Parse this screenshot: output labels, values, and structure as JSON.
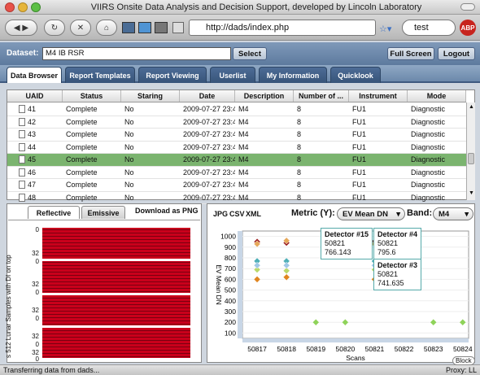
{
  "window": {
    "title": "VIIRS Onsite Data Analysis and Decision Support, developed by Lincoln Laboratory"
  },
  "toolbar": {
    "url": "http://dads/index.php",
    "search": "test",
    "abp": "ABP"
  },
  "dataset": {
    "label": "Dataset:",
    "value": "M4 IB RSR",
    "select_label": "Select",
    "fullscreen_label": "Full Screen",
    "logout_label": "Logout"
  },
  "tabs": [
    "Data Browser",
    "Report Templates",
    "Report Viewing",
    "Userlist",
    "My Information",
    "Quicklook"
  ],
  "table": {
    "columns": [
      "UAID",
      "Status",
      "Staring",
      "Date",
      "Description",
      "Number of ...",
      "Instrument",
      "Mode"
    ],
    "rows": [
      [
        "41",
        "Complete",
        "No",
        "2009-07-27 23:4",
        "M4",
        "8",
        "FU1",
        "Diagnostic"
      ],
      [
        "42",
        "Complete",
        "No",
        "2009-07-27 23:4",
        "M4",
        "8",
        "FU1",
        "Diagnostic"
      ],
      [
        "43",
        "Complete",
        "No",
        "2009-07-27 23:4",
        "M4",
        "8",
        "FU1",
        "Diagnostic"
      ],
      [
        "44",
        "Complete",
        "No",
        "2009-07-27 23:4",
        "M4",
        "8",
        "FU1",
        "Diagnostic"
      ],
      [
        "45",
        "Complete",
        "No",
        "2009-07-27 23:4",
        "M4",
        "8",
        "FU1",
        "Diagnostic"
      ],
      [
        "46",
        "Complete",
        "No",
        "2009-07-27 23:4",
        "M4",
        "8",
        "FU1",
        "Diagnostic"
      ],
      [
        "47",
        "Complete",
        "No",
        "2009-07-27 23:4",
        "M4",
        "8",
        "FU1",
        "Diagnostic"
      ],
      [
        "48",
        "Complete",
        "No",
        "2009-07-27 23:4",
        "M4",
        "8",
        "FU1",
        "Diagnostic"
      ]
    ],
    "selected_index": 4
  },
  "lower_left": {
    "tabs": [
      "Reflective",
      "Emissive"
    ],
    "download_label": "Download as PNG",
    "y_ticks": [
      "0",
      "32",
      "0",
      "32",
      "0",
      "32",
      "0",
      "32",
      "0",
      "32",
      "0"
    ],
    "y_label": "s 512 Lunar Samples with DI on top"
  },
  "chart_controls": {
    "links": [
      "JPG",
      "CSV",
      "XML"
    ],
    "metric_label": "Metric (Y):",
    "metric_value": "EV Mean DN",
    "band_label": "Band:",
    "band_value": "M4"
  },
  "chart_data": {
    "type": "scatter",
    "xlabel": "Scans",
    "ylabel": "EV Mean DN",
    "x_ticks": [
      50817,
      50818,
      50819,
      50820,
      50821,
      50822,
      50823,
      50824
    ],
    "y_ticks": [
      100,
      200,
      300,
      400,
      500,
      600,
      700,
      800,
      900,
      1000
    ],
    "xlim": [
      50816.5,
      50824.2
    ],
    "ylim": [
      50,
      1050
    ],
    "series": [
      {
        "color": "#e0851f",
        "points": [
          [
            50817,
            600
          ],
          [
            50818,
            620
          ],
          [
            50821,
            600
          ],
          [
            50822,
            620
          ]
        ]
      },
      {
        "color": "#9b1c1c",
        "points": [
          [
            50817,
            950
          ],
          [
            50818,
            940
          ],
          [
            50821,
            950
          ]
        ]
      },
      {
        "color": "#e6a85a",
        "points": [
          [
            50817,
            930
          ],
          [
            50818,
            960
          ],
          [
            50821,
            930
          ],
          [
            50822,
            950
          ]
        ]
      },
      {
        "color": "#4fb0b8",
        "points": [
          [
            50817,
            770
          ],
          [
            50818,
            770
          ],
          [
            50821,
            770
          ],
          [
            50822,
            770
          ]
        ]
      },
      {
        "color": "#b9d86a",
        "points": [
          [
            50817,
            690
          ],
          [
            50818,
            680
          ],
          [
            50821,
            690
          ],
          [
            50822,
            700
          ]
        ]
      },
      {
        "color": "#a0c8e6",
        "points": [
          [
            50817,
            730
          ],
          [
            50818,
            730
          ],
          [
            50821,
            730
          ],
          [
            50822,
            730
          ]
        ]
      },
      {
        "color": "#8fd35a",
        "points": [
          [
            50819,
            200
          ],
          [
            50820,
            200
          ],
          [
            50823,
            200
          ],
          [
            50824,
            200
          ]
        ]
      }
    ],
    "tooltips": [
      {
        "title": "Detector #15",
        "scan": "50821",
        "value": "766.143"
      },
      {
        "title": "Detector #4",
        "scan": "50821",
        "value": "795.6"
      },
      {
        "title": "Detector #3",
        "scan": "50821",
        "value": "741.635"
      }
    ]
  },
  "status": {
    "text": "Transferring data from dads...",
    "proxy": "Proxy: LL",
    "block": "Block"
  }
}
